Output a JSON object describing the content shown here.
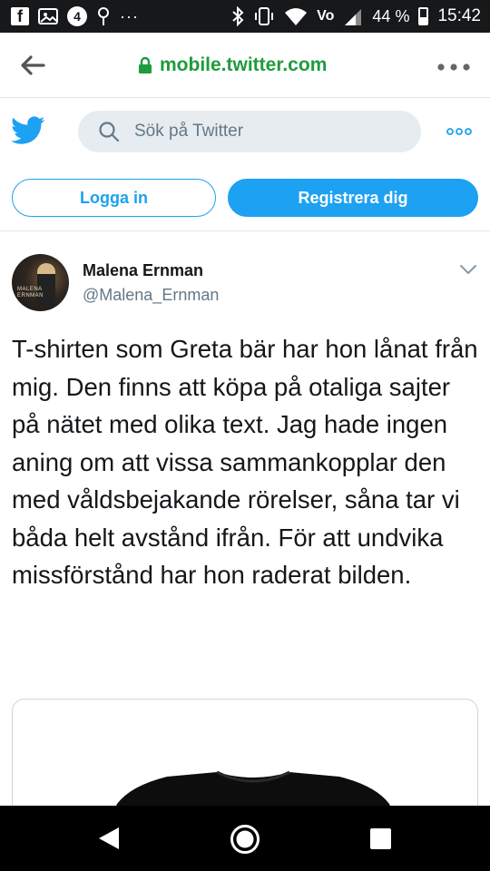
{
  "status_bar": {
    "battery": "44 %",
    "time": "15:42",
    "network_label": "Vo",
    "notification_count": "4",
    "overflow": "···"
  },
  "browser": {
    "url": "mobile.twitter.com"
  },
  "header": {
    "search_placeholder": "Sök på Twitter"
  },
  "auth": {
    "login_label": "Logga in",
    "signup_label": "Registrera dig"
  },
  "tweet": {
    "display_name": "Malena Ernman",
    "handle": "@Malena_Ernman",
    "text": "T-shirten som Greta bär har hon lånat från mig. Den finns att köpa på otaliga sajter på nätet med olika text. Jag hade ingen aning om att vissa sammankopplar den med våldsbejakande rörelser, såna tar vi båda helt avstånd ifrån. För att undvika missförstånd har hon raderat bilden.",
    "avatar_caption": "MALENA ERNMAN"
  },
  "colors": {
    "twitter_blue": "#1da1f2",
    "url_green": "#1e9b3d",
    "status_bar_bg": "#16181a",
    "text_primary": "#14171a",
    "text_secondary": "#657786"
  }
}
